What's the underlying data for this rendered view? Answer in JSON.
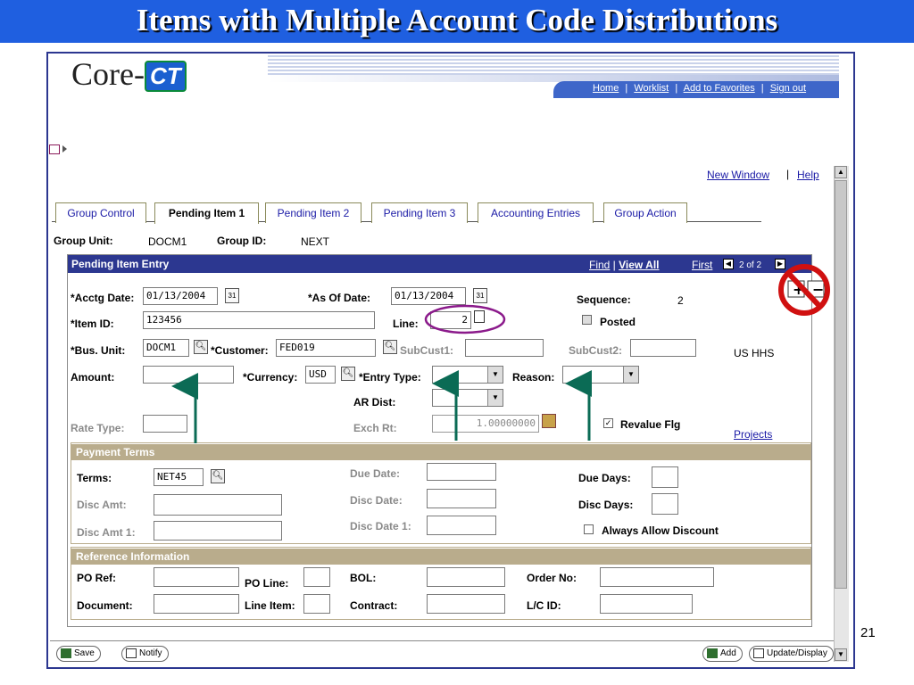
{
  "slide": {
    "title": "Items with Multiple Account Code Distributions",
    "number": "21"
  },
  "header": {
    "logo_core": "Core-",
    "logo_ct": "CT",
    "nav_links": [
      "Home",
      "Worklist",
      "Add to Favorites",
      "Sign out"
    ],
    "new_window": "New Window",
    "help": "Help"
  },
  "tabs": [
    {
      "label": "Group Control",
      "active": false
    },
    {
      "label": "Pending Item 1",
      "active": true
    },
    {
      "label": "Pending Item 2",
      "active": false
    },
    {
      "label": "Pending Item 3",
      "active": false
    },
    {
      "label": "Accounting Entries",
      "active": false
    },
    {
      "label": "Group Action",
      "active": false
    }
  ],
  "group": {
    "unit_label": "Group Unit:",
    "unit_value": "DOCM1",
    "id_label": "Group ID:",
    "id_value": "NEXT"
  },
  "entry": {
    "title": "Pending Item Entry",
    "find": "Find",
    "view_all": "View All",
    "first": "First",
    "count": "2 of 2",
    "acctg_date_label": "*Acctg Date:",
    "acctg_date": "01/13/2004",
    "as_of_date_label": "*As Of Date:",
    "as_of_date": "01/13/2004",
    "sequence_label": "Sequence:",
    "sequence": "2",
    "item_id_label": "*Item ID:",
    "item_id": "123456",
    "line_label": "Line:",
    "line": "2",
    "posted_label": "Posted",
    "bus_unit_label": "*Bus. Unit:",
    "bus_unit": "DOCM1",
    "customer_label": "*Customer:",
    "customer": "FED019",
    "subcust1_label": "SubCust1:",
    "subcust2_label": "SubCust2:",
    "customer_name": "US HHS",
    "amount_label": "Amount:",
    "currency_label": "*Currency:",
    "currency": "USD",
    "entry_type_label": "*Entry Type:",
    "reason_label": "Reason:",
    "ar_dist_label": "AR Dist:",
    "rate_type_label": "Rate Type:",
    "exch_rt_label": "Exch Rt:",
    "exch_rt": "1.00000000",
    "revalue_label": "Revalue Flg",
    "projects": "Projects"
  },
  "payment_terms": {
    "title": "Payment Terms",
    "terms_label": "Terms:",
    "terms": "NET45",
    "due_date_label": "Due Date:",
    "due_days_label": "Due Days:",
    "disc_amt_label": "Disc Amt:",
    "disc_date_label": "Disc Date:",
    "disc_days_label": "Disc Days:",
    "disc_amt1_label": "Disc Amt 1:",
    "disc_date1_label": "Disc Date 1:",
    "always_allow_label": "Always Allow Discount"
  },
  "reference": {
    "title": "Reference Information",
    "po_ref_label": "PO Ref:",
    "po_line_label": "PO Line:",
    "bol_label": "BOL:",
    "order_no_label": "Order No:",
    "document_label": "Document:",
    "line_item_label": "Line Item:",
    "contract_label": "Contract:",
    "lc_id_label": "L/C ID:"
  },
  "footer": {
    "save": "Save",
    "notify": "Notify",
    "add": "Add",
    "update_display": "Update/Display"
  },
  "colors": {
    "title_bar": "#1f5fe0",
    "entry_bar": "#2c3790",
    "section": "#b9ac8c",
    "annotation_arrow": "#0b6b55",
    "annotation_circle": "#8b1a8b",
    "prohibited": "#d01010"
  }
}
